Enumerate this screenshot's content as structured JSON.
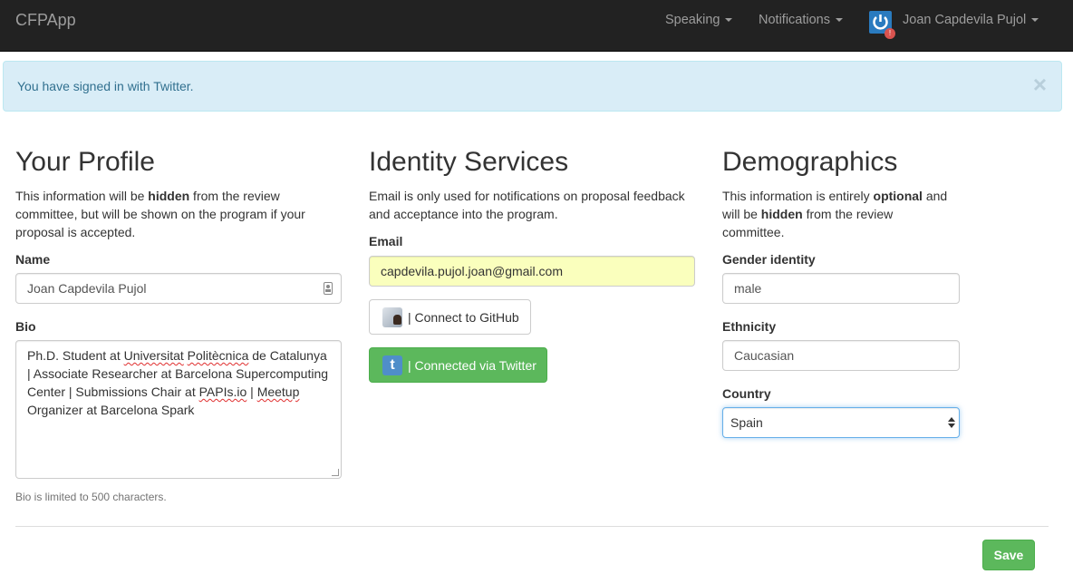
{
  "navbar": {
    "brand": "CFPApp",
    "speaking": "Speaking",
    "notifications": "Notifications",
    "user_name": "Joan Capdevila Pujol",
    "avatar_badge": "!"
  },
  "alert": {
    "message": "You have signed in with Twitter.",
    "close": "×"
  },
  "profile": {
    "title": "Your Profile",
    "help_prefix": "This information will be ",
    "help_bold": "hidden",
    "help_suffix": " from the review committee, but will be shown on the program if your proposal is accepted.",
    "name_label": "Name",
    "name_value": "Joan Capdevila Pujol",
    "bio_label": "Bio",
    "bio_parts": {
      "p1": "Ph.D. Student at ",
      "w1": "Universitat",
      "p2": " ",
      "w2": "Politècnica",
      "p3": " de Catalunya | Associate Researcher at Barcelona Supercomputing Center | Submissions Chair at ",
      "w3": "PAPIs.io",
      "p4": " | ",
      "w4": "Meetup",
      "p5": " Organizer at Barcelona Spark"
    },
    "bio_help": "Bio is limited to 500 characters."
  },
  "identity": {
    "title": "Identity Services",
    "help": "Email is only used for notifications on proposal feedback and acceptance into the program.",
    "email_label": "Email",
    "email_value": "capdevila.pujol.joan@gmail.com",
    "github_label": "| Connect to GitHub",
    "twitter_label": "| Connected via Twitter",
    "twitter_glyph": "t"
  },
  "demographics": {
    "title": "Demographics",
    "help_prefix": "This information is entirely ",
    "help_bold1": "optional",
    "help_mid": " and will be ",
    "help_bold2": "hidden",
    "help_suffix": " from the review committee.",
    "gender_label": "Gender identity",
    "gender_value": "male",
    "ethnicity_label": "Ethnicity",
    "ethnicity_value": "Caucasian",
    "country_label": "Country",
    "country_value": "Spain"
  },
  "actions": {
    "save_label": "Save"
  },
  "colors": {
    "navbar_bg": "#222222",
    "alert_bg": "#d9edf7",
    "success": "#5cb85c",
    "autofill": "#faffbd"
  }
}
